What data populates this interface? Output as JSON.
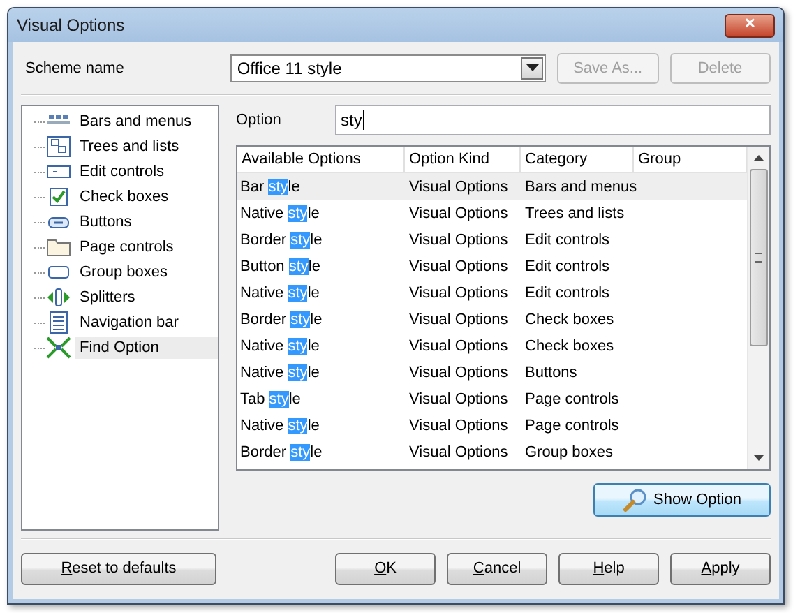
{
  "window": {
    "title": "Visual Options",
    "close": "✕"
  },
  "scheme": {
    "label": "Scheme name",
    "value": "Office 11 style",
    "save_as": {
      "label": "Save As...",
      "disabled": true
    },
    "delete": {
      "label": "Delete",
      "disabled": true
    }
  },
  "tree": {
    "items": [
      {
        "label": "Bars and menus",
        "selected": false
      },
      {
        "label": "Trees and lists",
        "selected": false
      },
      {
        "label": "Edit controls",
        "selected": false
      },
      {
        "label": "Check boxes",
        "selected": false
      },
      {
        "label": "Buttons",
        "selected": false
      },
      {
        "label": "Page controls",
        "selected": false
      },
      {
        "label": "Group boxes",
        "selected": false
      },
      {
        "label": "Splitters",
        "selected": false
      },
      {
        "label": "Navigation bar",
        "selected": false
      },
      {
        "label": "Find Option",
        "selected": true
      }
    ]
  },
  "option": {
    "label": "Option",
    "value": "sty"
  },
  "table": {
    "columns": [
      "Available Options",
      "Option Kind",
      "Category",
      "Group"
    ],
    "rows": [
      {
        "name": {
          "before": "Bar ",
          "match": "sty",
          "after": "le"
        },
        "kind": "Visual Options",
        "category": "Bars and menus",
        "selected": true
      },
      {
        "name": {
          "before": "Native ",
          "match": "sty",
          "after": "le"
        },
        "kind": "Visual Options",
        "category": "Trees and lists",
        "selected": false
      },
      {
        "name": {
          "before": "Border ",
          "match": "sty",
          "after": "le"
        },
        "kind": "Visual Options",
        "category": "Edit controls",
        "selected": false
      },
      {
        "name": {
          "before": "Button ",
          "match": "sty",
          "after": "le"
        },
        "kind": "Visual Options",
        "category": "Edit controls",
        "selected": false
      },
      {
        "name": {
          "before": "Native ",
          "match": "sty",
          "after": "le"
        },
        "kind": "Visual Options",
        "category": "Edit controls",
        "selected": false
      },
      {
        "name": {
          "before": "Border ",
          "match": "sty",
          "after": "le"
        },
        "kind": "Visual Options",
        "category": "Check boxes",
        "selected": false
      },
      {
        "name": {
          "before": "Native ",
          "match": "sty",
          "after": "le"
        },
        "kind": "Visual Options",
        "category": "Check boxes",
        "selected": false
      },
      {
        "name": {
          "before": "Native ",
          "match": "sty",
          "after": "le"
        },
        "kind": "Visual Options",
        "category": "Buttons",
        "selected": false
      },
      {
        "name": {
          "before": "Tab ",
          "match": "sty",
          "after": "le"
        },
        "kind": "Visual Options",
        "category": "Page controls",
        "selected": false
      },
      {
        "name": {
          "before": "Native ",
          "match": "sty",
          "after": "le"
        },
        "kind": "Visual Options",
        "category": "Page controls",
        "selected": false
      },
      {
        "name": {
          "before": "Border ",
          "match": "sty",
          "after": "le"
        },
        "kind": "Visual Options",
        "category": "Group boxes",
        "selected": false
      }
    ]
  },
  "show_option": {
    "label": "Show Option"
  },
  "buttons": [
    {
      "key": "R",
      "rest": "eset to defaults"
    },
    {
      "key": "O",
      "rest": "K"
    },
    {
      "key": "C",
      "rest": "ancel"
    },
    {
      "key": "H",
      "rest": "elp"
    },
    {
      "key": "A",
      "rest": "pply"
    }
  ]
}
